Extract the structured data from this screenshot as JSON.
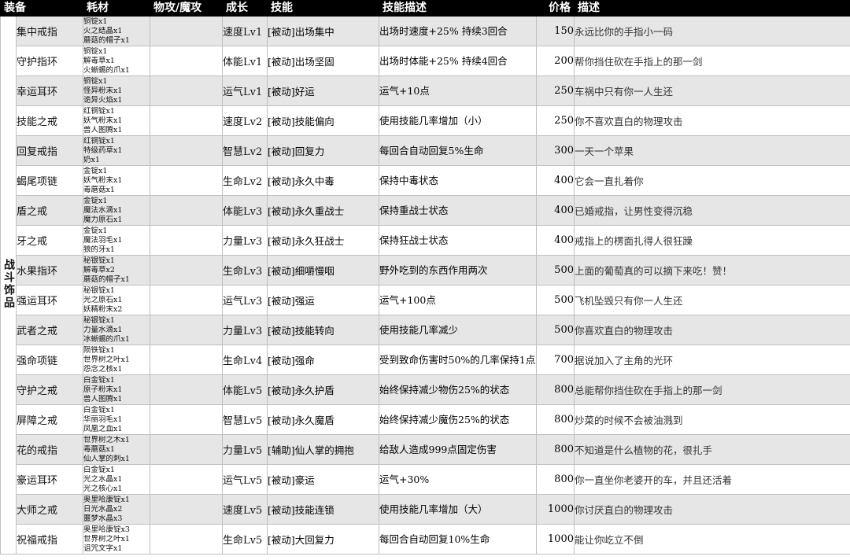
{
  "headers": {
    "equip": "装备",
    "materials": "耗材",
    "atk_type": "物攻/魔攻",
    "growth": "成长",
    "skill": "技能",
    "skill_desc": "技能描述",
    "price": "价格",
    "note": "描述"
  },
  "category": "战斗饰品",
  "rows": [
    {
      "name": "集中戒指",
      "materials": [
        "铜锭x1",
        "火之结晶x1",
        "蘑菇的帽子x1"
      ],
      "atk": "",
      "growth": "速度Lv1",
      "skill": "[被动]出场集中",
      "desc": "出场时速度+25% 持续3回合",
      "price": "150",
      "note": "永远比你的手指小一码"
    },
    {
      "name": "守护指环",
      "materials": [
        "铜锭x1",
        "解毒草x1",
        "火蜥蜴的爪x1"
      ],
      "atk": "",
      "growth": "体能Lv1",
      "skill": "[被动]出场坚固",
      "desc": "出场时体能+25% 持续4回合",
      "price": "200",
      "note": "帮你挡住砍在手指上的那一剑"
    },
    {
      "name": "幸运耳环",
      "materials": [
        "铜锭x1",
        "怪异粉末x1",
        "诡异火焰x1"
      ],
      "atk": "",
      "growth": "运气Lv1",
      "skill": "[被动]好运",
      "desc": "运气+10点",
      "price": "250",
      "note": "车祸中只有你一人生还"
    },
    {
      "name": "技能之戒",
      "materials": [
        "红铜锭x1",
        "妖气粉末x1",
        "兽人图腾x1"
      ],
      "atk": "",
      "growth": "速度Lv2",
      "skill": "[被动]技能偏向",
      "desc": "使用技能几率增加（小）",
      "price": "250",
      "note": "你不喜欢直白的物理攻击"
    },
    {
      "name": "回复戒指",
      "materials": [
        "红铜锭x1",
        "特级药草x1",
        "奶x1"
      ],
      "atk": "",
      "growth": "智慧Lv2",
      "skill": "[被动]回复力",
      "desc": "每回合自动回复5%生命",
      "price": "300",
      "note": "一天一个苹果"
    },
    {
      "name": "蝎尾项链",
      "materials": [
        "金锭x1",
        "妖气粉末x1",
        "毒蘑菇x1"
      ],
      "atk": "",
      "growth": "生命Lv2",
      "skill": "[被动]永久中毒",
      "desc": "保持中毒状态",
      "price": "400",
      "note": "它会一直扎着你"
    },
    {
      "name": "盾之戒",
      "materials": [
        "金锭x1",
        "魔法水滴x1",
        "魔力原石x1"
      ],
      "atk": "",
      "growth": "体能Lv3",
      "skill": "[被动]永久重战士",
      "desc": "保持重战士状态",
      "price": "400",
      "note": "已婚戒指，让男性变得沉稳"
    },
    {
      "name": "牙之戒",
      "materials": [
        "金锭x1",
        "魔法羽毛x1",
        "狼的牙x1"
      ],
      "atk": "",
      "growth": "力量Lv3",
      "skill": "[被动]永久狂战士",
      "desc": "保持狂战士状态",
      "price": "400",
      "note": "戒指上的楞面扎得人很狂躁"
    },
    {
      "name": "水果指环",
      "materials": [
        "秘银锭x1",
        "解毒草x2",
        "蘑菇的帽子x1"
      ],
      "atk": "",
      "growth": "生命Lv3",
      "skill": "[被动]细嚼慢咽",
      "desc": "野外吃到的东西作用两次",
      "price": "500",
      "note": "上面的葡萄真的可以摘下来吃！赞！"
    },
    {
      "name": "强运耳环",
      "materials": [
        "秘银锭x1",
        "光之原石x1",
        "妖精粉末x2"
      ],
      "atk": "",
      "growth": "运气Lv3",
      "skill": "[被动]强运",
      "desc": "运气+100点",
      "price": "500",
      "note": "飞机坠毁只有你一人生还"
    },
    {
      "name": "武者之戒",
      "materials": [
        "秘银锭x1",
        "力量水滴x1",
        "冰蜥蜴的爪x1"
      ],
      "atk": "",
      "growth": "力量Lv3",
      "skill": "[被动]技能转向",
      "desc": "使用技能几率减少",
      "price": "500",
      "note": "你喜欢直白的物理攻击"
    },
    {
      "name": "强命项链",
      "materials": [
        "陨铁锭x1",
        "世界树之叶x1",
        "怨念之核x1"
      ],
      "atk": "",
      "growth": "生命Lv4",
      "skill": "[被动]强命",
      "desc": "受到致命伤害时50%的几率保持1点血",
      "price": "700",
      "note": "据说加入了主角的光环"
    },
    {
      "name": "守护之戒",
      "materials": [
        "白金锭x1",
        "原子粉末x1",
        "兽人图腾x1"
      ],
      "atk": "",
      "growth": "体能Lv5",
      "skill": "[被动]永久护盾",
      "desc": "始终保持减少物伤25%的状态",
      "price": "800",
      "note": "总能帮你挡住砍在手指上的那一剑"
    },
    {
      "name": "屏障之戒",
      "materials": [
        "白金锭x1",
        "华丽羽毛x1",
        "凤凰之血x1"
      ],
      "atk": "",
      "growth": "智慧Lv5",
      "skill": "[被动]永久魔盾",
      "desc": "始终保持减少魔伤25%的状态",
      "price": "800",
      "note": "炒菜的时候不会被油溅到"
    },
    {
      "name": "花的戒指",
      "materials": [
        "世界树之木x1",
        "毒蘑菇x1",
        "仙人掌的刺x1"
      ],
      "atk": "",
      "growth": "力量Lv5",
      "skill": "[辅助]仙人掌的拥抱",
      "desc": "给敌人造成999点固定伤害",
      "price": "800",
      "note": "不知道是什么植物的花，很扎手"
    },
    {
      "name": "豪运耳环",
      "materials": [
        "白金锭x1",
        "光之水晶x1",
        "光之核心x1"
      ],
      "atk": "",
      "growth": "运气Lv5",
      "skill": "[被动]豪运",
      "desc": "运气+30%",
      "price": "800",
      "note": "你一直坐你老婆开的车，并且还活着"
    },
    {
      "name": "大师之戒",
      "materials": [
        "奥里哈康锭x1",
        "日光水晶x2",
        "噩梦水晶x3"
      ],
      "atk": "",
      "growth": "速度Lv5",
      "skill": "[被动]技能连锁",
      "desc": "使用技能几率增加（大）",
      "price": "1000",
      "note": "你讨厌直白的物理攻击"
    },
    {
      "name": "祝福戒指",
      "materials": [
        "奥里哈康锭x3",
        "世界树之叶x1",
        "诅咒文字x1"
      ],
      "atk": "",
      "growth": "生命Lv5",
      "skill": "[被动]大回复力",
      "desc": "每回合自动回复10%生命",
      "price": "1000",
      "note": "能让你屹立不倒"
    }
  ]
}
